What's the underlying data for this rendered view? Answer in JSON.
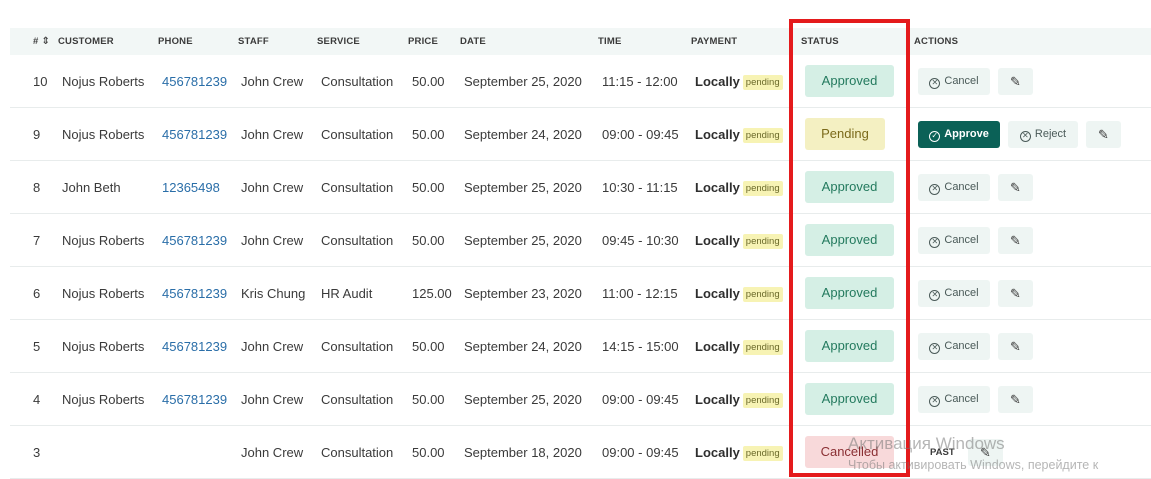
{
  "columns": {
    "num": "#",
    "customer": "CUSTOMER",
    "phone": "PHONE",
    "staff": "STAFF",
    "service": "SERVICE",
    "price": "PRICE",
    "date": "DATE",
    "time": "TIME",
    "payment": "PAYMENT",
    "status": "STATUS",
    "actions": "ACTIONS"
  },
  "rows": [
    {
      "num": "10",
      "customer": "Nojus Roberts",
      "phone": "456781239",
      "staff": "John Crew",
      "service": "Consultation",
      "price": "50.00",
      "date": "September 25, 2020",
      "time": "11:15 - 12:00",
      "payment_method": "Locally",
      "payment_status": "pending",
      "status": "Approved",
      "actions": {
        "cancel": "Cancel"
      }
    },
    {
      "num": "9",
      "customer": "Nojus Roberts",
      "phone": "456781239",
      "staff": "John Crew",
      "service": "Consultation",
      "price": "50.00",
      "date": "September 24, 2020",
      "time": "09:00 - 09:45",
      "payment_method": "Locally",
      "payment_status": "pending",
      "status": "Pending",
      "actions": {
        "approve": "Approve",
        "reject": "Reject"
      }
    },
    {
      "num": "8",
      "customer": "John Beth",
      "phone": "12365498",
      "staff": "John Crew",
      "service": "Consultation",
      "price": "50.00",
      "date": "September 25, 2020",
      "time": "10:30 - 11:15",
      "payment_method": "Locally",
      "payment_status": "pending",
      "status": "Approved",
      "actions": {
        "cancel": "Cancel"
      }
    },
    {
      "num": "7",
      "customer": "Nojus Roberts",
      "phone": "456781239",
      "staff": "John Crew",
      "service": "Consultation",
      "price": "50.00",
      "date": "September 25, 2020",
      "time": "09:45 - 10:30",
      "payment_method": "Locally",
      "payment_status": "pending",
      "status": "Approved",
      "actions": {
        "cancel": "Cancel"
      }
    },
    {
      "num": "6",
      "customer": "Nojus Roberts",
      "phone": "456781239",
      "staff": "Kris Chung",
      "service": "HR Audit",
      "price": "125.00",
      "date": "September 23, 2020",
      "time": "11:00 - 12:15",
      "payment_method": "Locally",
      "payment_status": "pending",
      "status": "Approved",
      "actions": {
        "cancel": "Cancel"
      }
    },
    {
      "num": "5",
      "customer": "Nojus Roberts",
      "phone": "456781239",
      "staff": "John Crew",
      "service": "Consultation",
      "price": "50.00",
      "date": "September 24, 2020",
      "time": "14:15 - 15:00",
      "payment_method": "Locally",
      "payment_status": "pending",
      "status": "Approved",
      "actions": {
        "cancel": "Cancel"
      }
    },
    {
      "num": "4",
      "customer": "Nojus Roberts",
      "phone": "456781239",
      "staff": "John Crew",
      "service": "Consultation",
      "price": "50.00",
      "date": "September 25, 2020",
      "time": "09:00 - 09:45",
      "payment_method": "Locally",
      "payment_status": "pending",
      "status": "Approved",
      "actions": {
        "cancel": "Cancel"
      }
    },
    {
      "num": "3",
      "customer": "",
      "phone": "",
      "staff": "John Crew",
      "service": "Consultation",
      "price": "50.00",
      "date": "September 18, 2020",
      "time": "09:00 - 09:45",
      "payment_method": "Locally",
      "payment_status": "pending",
      "status": "Cancelled",
      "actions": {
        "past": "PAST"
      }
    }
  ],
  "icons": {
    "sort": "sort-icon",
    "cancel": "circle-x-icon",
    "approve": "circle-check-icon",
    "reject": "circle-x-icon",
    "edit": "pencil-icon"
  },
  "colors": {
    "highlight": "#e41a1c",
    "approved_bg": "#d5efe5",
    "pending_bg": "#f4f0c2",
    "cancelled_bg": "#f8d9da",
    "primary_button": "#0b6157",
    "link": "#2a6ea8"
  },
  "watermark": {
    "title": "Активация Windows",
    "subtitle": "Чтобы активировать Windows, перейдите к"
  }
}
